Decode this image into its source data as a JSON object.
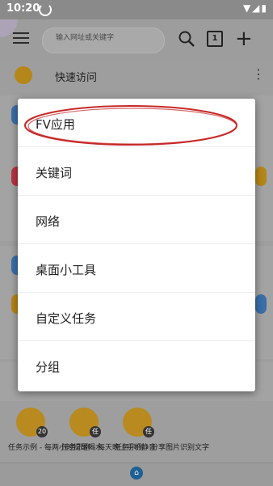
{
  "status_bar": {
    "time": "10:20"
  },
  "top_bar": {
    "search_placeholder": "输入网址或关键字",
    "tab_count": "1"
  },
  "quick_access": {
    "label": "快速访问"
  },
  "popup_menu": {
    "items": [
      {
        "label": "FV应用"
      },
      {
        "label": "关键词"
      },
      {
        "label": "网络"
      },
      {
        "label": "桌面小工具"
      },
      {
        "label": "自定义任务"
      },
      {
        "label": "分组"
      }
    ]
  },
  "tasks": [
    {
      "label": "任务示例 - 每两小时提醒喝水",
      "badge": "20"
    },
    {
      "label": "任务示例 - 每天晚上手机静音",
      "badge": "任"
    },
    {
      "label": "任务示例 - 分享图片识别文字",
      "badge": "任"
    }
  ],
  "colors": {
    "accent": "#b58619",
    "annotation": "#c62828",
    "overlay": "#9e9e9e"
  }
}
